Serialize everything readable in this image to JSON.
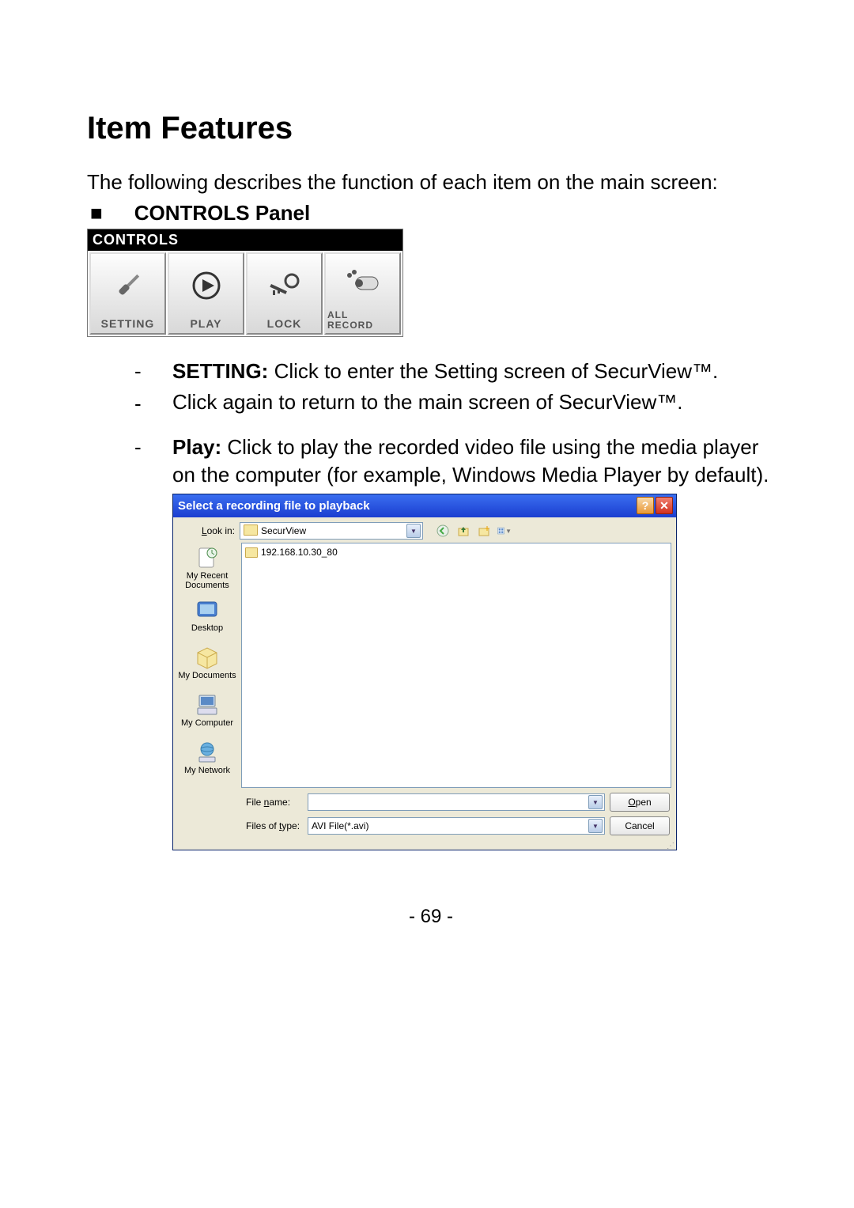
{
  "heading": "Item Features",
  "intro": "The following describes the function of each item on the main screen:",
  "section_bullet": "■",
  "section_title": "CONTROLS Panel",
  "controls_panel": {
    "header": "CONTROLS",
    "buttons": {
      "setting": "SETTING",
      "play": "PLAY",
      "lock": "LOCK",
      "all_record_l1": "ALL",
      "all_record_l2": "RECORD"
    }
  },
  "items": {
    "setting_label": "SETTING:",
    "setting_text": "  Click to enter the Setting screen of SecurView™.",
    "setting_return": "Click again to return to the main screen of SecurView™.",
    "play_label": "Play:",
    "play_text": "  Click to play the recorded video file using the media player on the computer (for example, Windows Media Player by default)."
  },
  "dialog": {
    "title": "Select a recording file to playback",
    "help_btn": "?",
    "close_btn": "✕",
    "look_in_label": "Look in:",
    "look_in_value": "SecurView",
    "file_item": "192.168.10.30_80",
    "places": {
      "recent": "My Recent Documents",
      "desktop": "Desktop",
      "mydocs": "My Documents",
      "mycomp": "My Computer",
      "mynet": "My Network"
    },
    "filename_label": "File name:",
    "filename_value": "",
    "filetype_label": "Files of type:",
    "filetype_value": "AVI File(*.avi)",
    "open_btn": "Open",
    "cancel_btn": "Cancel"
  },
  "page_number": "- 69 -"
}
